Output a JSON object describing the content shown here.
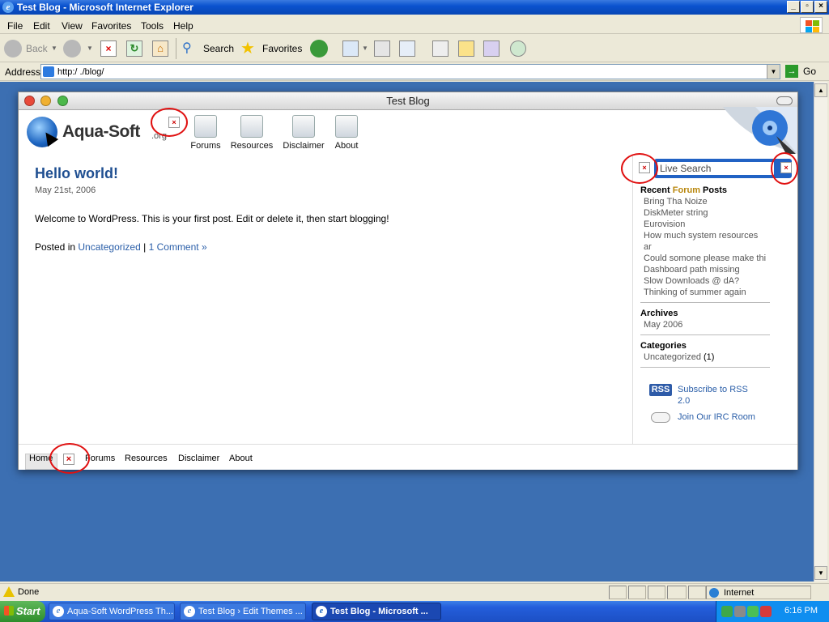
{
  "window": {
    "title": "Test Blog - Microsoft Internet Explorer"
  },
  "menu": [
    "File",
    "Edit",
    "View",
    "Favorites",
    "Tools",
    "Help"
  ],
  "toolbar": {
    "back": "Back",
    "search": "Search",
    "favorites": "Favorites"
  },
  "address": {
    "label": "Address",
    "url": "http:/                    ./blog/",
    "go": "Go"
  },
  "page": {
    "window_title": "Test Blog",
    "logo": {
      "text": "Aqua-Soft",
      "suffix": ".org"
    },
    "nav": [
      "Forums",
      "Resources",
      "Disclaimer",
      "About"
    ],
    "post": {
      "title": "Hello world!",
      "date": "May 21st, 2006",
      "body": "Welcome to WordPress. This is your first post. Edit or delete it, then start blogging!",
      "posted_in": "Posted in",
      "category": "Uncategorized",
      "sep": "|",
      "comments": "1 Comment »"
    },
    "sidebar": {
      "search_placeholder": "Live Search",
      "recent": {
        "w1": "Recent",
        "w2": "Forum",
        "w3": "Posts"
      },
      "recent_items": [
        "Bring Tha Noize",
        "DiskMeter string",
        "Eurovision",
        "How much system resources",
        "ar",
        "Could somone please make thi",
        "Dashboard path missing",
        "Slow Downloads @ dA?",
        "Thinking of summer again"
      ],
      "archives_title": "Archives",
      "archives": [
        "May 2006"
      ],
      "categories_title": "Categories",
      "category_item": "Uncategorized",
      "category_count": "(1)",
      "rss_badge": "RSS",
      "rss_line1": "Subscribe to RSS",
      "rss_line2": "2.0",
      "irc": "Join Our IRC Room"
    },
    "footer_nav": [
      "Home",
      "Forums",
      "Resources",
      "Disclaimer",
      "About"
    ]
  },
  "status": {
    "text": "Done",
    "zone": "Internet"
  },
  "taskbar": {
    "start": "Start",
    "tasks": [
      "Aqua-Soft WordPress Th...",
      "Test Blog › Edit Themes ...",
      "Test Blog - Microsoft ..."
    ],
    "clock": "6:16 PM"
  },
  "colors": {
    "link": "#2a5ea8",
    "title": "#1f4f91",
    "desktop": "#3c6fb2",
    "annotation": "#e01010"
  }
}
